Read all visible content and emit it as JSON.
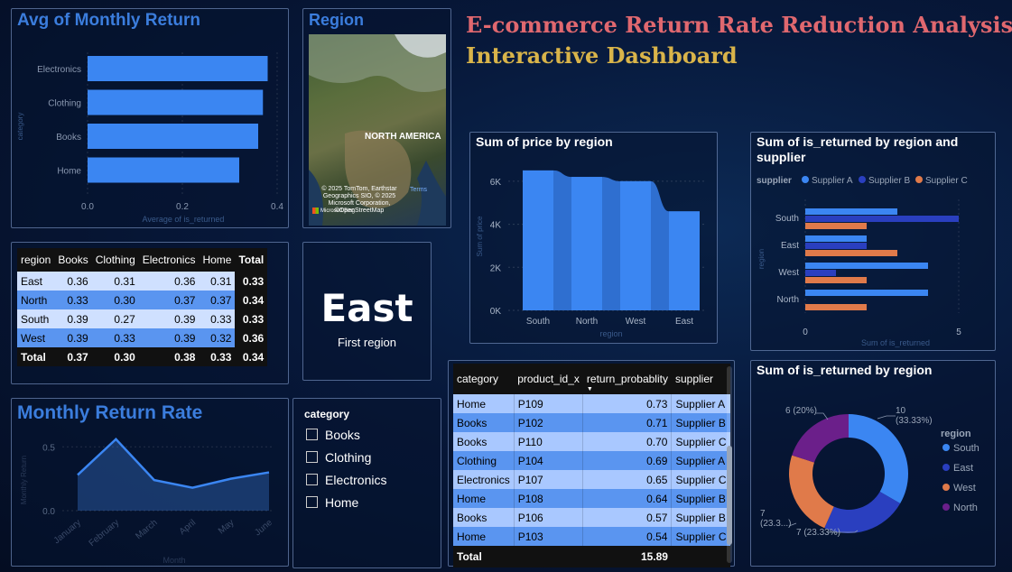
{
  "dashboard": {
    "title_line1": "E-commerce Return Rate Reduction Analysis",
    "title_line2": "Interactive Dashboard"
  },
  "avg_monthly": {
    "title": "Avg of Monthly Return",
    "ylabel": "category",
    "xlabel": "Average of is_returned",
    "ticks": [
      "0.0",
      "0.2",
      "0.4"
    ]
  },
  "region_map": {
    "title": "Region",
    "map_label": "NORTH AMERICA",
    "attribution": "© 2025 TomTom, Earthstar Geographics SIO, © 2025 Microsoft Corporation, ©OpenStreetMap",
    "terms": "Terms",
    "ms_bing": "Microsoft Bing"
  },
  "matrix": {
    "headers": [
      "region",
      "Books",
      "Clothing",
      "Electronics",
      "Home",
      "Total"
    ],
    "rows": [
      [
        "East",
        "0.36",
        "0.31",
        "0.36",
        "0.31",
        "0.33"
      ],
      [
        "North",
        "0.33",
        "0.30",
        "0.37",
        "0.37",
        "0.34"
      ],
      [
        "South",
        "0.39",
        "0.27",
        "0.39",
        "0.33",
        "0.33"
      ],
      [
        "West",
        "0.39",
        "0.33",
        "0.39",
        "0.32",
        "0.36"
      ]
    ],
    "total": [
      "Total",
      "0.37",
      "0.30",
      "0.38",
      "0.33",
      "0.34"
    ],
    "row_colors": [
      "#cfe0ff",
      "#5a95f0",
      "#cfe0ff",
      "#5a95f0"
    ]
  },
  "card": {
    "value": "East",
    "label": "First region"
  },
  "monthly_rate": {
    "title": "Monthly Return Rate",
    "xlabel": "Month",
    "ylabel": "Monthly Return",
    "ticks": [
      "0.0",
      "0.5"
    ]
  },
  "slicer": {
    "title": "category",
    "items": [
      "Books",
      "Clothing",
      "Electronics",
      "Home"
    ]
  },
  "detail_table": {
    "headers": [
      "category",
      "product_id_x",
      "return_probablity",
      "supplier"
    ],
    "rows": [
      [
        "Home",
        "P109",
        "0.73",
        "Supplier A"
      ],
      [
        "Books",
        "P102",
        "0.71",
        "Supplier B"
      ],
      [
        "Books",
        "P110",
        "0.70",
        "Supplier C"
      ],
      [
        "Clothing",
        "P104",
        "0.69",
        "Supplier A"
      ],
      [
        "Electronics",
        "P107",
        "0.65",
        "Supplier C"
      ],
      [
        "Home",
        "P108",
        "0.64",
        "Supplier B"
      ],
      [
        "Books",
        "P106",
        "0.57",
        "Supplier B"
      ],
      [
        "Home",
        "P103",
        "0.54",
        "Supplier C"
      ]
    ],
    "total_label": "Total",
    "total_value": "15.89",
    "sort_icon": "sort-desc-icon"
  },
  "price_region": {
    "title": "Sum of price by region",
    "xlabel": "region",
    "ylabel": "Sum of price"
  },
  "supplier_chart": {
    "title": "Sum of is_returned by region and supplier",
    "legend_label": "supplier",
    "xlabel": "Sum of is_returned",
    "ylabel": "region"
  },
  "donut": {
    "title": "Sum of is_returned by region",
    "legend_title": "region",
    "labels": [
      "10 (33.33%)",
      "7 (23.33%)",
      "7 (23.3...)",
      "6 (20%)"
    ]
  },
  "colors": {
    "primary_blue": "#3b86f2",
    "dark_blue": "#2a3fbf",
    "orange": "#e07a4a",
    "purple": "#6b1f8a"
  },
  "chart_data": [
    {
      "type": "bar",
      "orientation": "horizontal",
      "title": "Avg of Monthly Return",
      "categories": [
        "Electronics",
        "Clothing",
        "Books",
        "Home"
      ],
      "values": [
        0.38,
        0.37,
        0.36,
        0.32
      ],
      "xlabel": "Average of is_returned",
      "ylabel": "category",
      "xlim": [
        0,
        0.4
      ]
    },
    {
      "type": "line",
      "title": "Monthly Return Rate",
      "x": [
        "January",
        "February",
        "March",
        "April",
        "May",
        "June"
      ],
      "values": [
        0.28,
        0.56,
        0.24,
        0.18,
        0.25,
        0.3
      ],
      "xlabel": "Month",
      "ylabel": "Monthly Return",
      "ylim": [
        0,
        0.7
      ]
    },
    {
      "type": "bar",
      "title": "Sum of price by region",
      "categories": [
        "South",
        "North",
        "West",
        "East"
      ],
      "values": [
        6500,
        6200,
        6000,
        4600
      ],
      "xlabel": "region",
      "ylabel": "Sum of price",
      "yticks": [
        "0K",
        "2K",
        "4K",
        "6K"
      ],
      "ylim": [
        0,
        7000
      ]
    },
    {
      "type": "bar",
      "orientation": "horizontal",
      "title": "Sum of is_returned by region and supplier",
      "categories": [
        "South",
        "East",
        "West",
        "North"
      ],
      "series": [
        {
          "name": "Supplier A",
          "values": [
            3,
            2,
            4,
            4
          ]
        },
        {
          "name": "Supplier B",
          "values": [
            5,
            2,
            1,
            0
          ]
        },
        {
          "name": "Supplier C",
          "values": [
            2,
            3,
            2,
            2
          ]
        }
      ],
      "xticks": [
        "0",
        "5"
      ],
      "xlim": [
        0,
        5
      ],
      "xlabel": "Sum of is_returned",
      "ylabel": "region"
    },
    {
      "type": "pie",
      "title": "Sum of is_returned by region",
      "categories": [
        "South",
        "East",
        "West",
        "North"
      ],
      "values": [
        10,
        7,
        7,
        6
      ],
      "legend_position": "right"
    }
  ]
}
